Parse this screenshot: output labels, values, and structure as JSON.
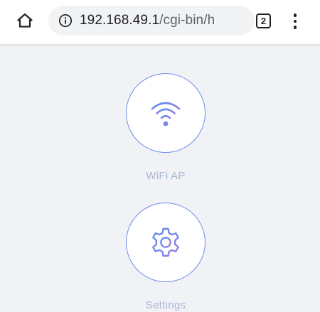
{
  "browser": {
    "url_host": "192.168.49.1",
    "url_path": "/cgi-bin/h",
    "tab_count": "2",
    "icons": {
      "home": "home-icon",
      "info": "info-icon",
      "menu": "more-vert-icon"
    }
  },
  "main": {
    "tiles": [
      {
        "label": "WiFi AP",
        "icon": "wifi-icon"
      },
      {
        "label": "Settings",
        "icon": "gear-icon"
      }
    ]
  },
  "colors": {
    "accent_gradient_start": "#5b8ff0",
    "accent_gradient_end": "#9a7fe6",
    "label_color": "#a9b6d6",
    "page_background": "#f1f2f6"
  }
}
